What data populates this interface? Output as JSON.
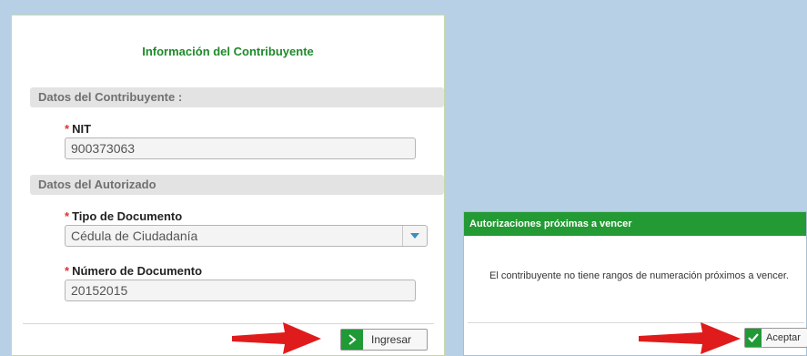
{
  "form": {
    "title": "Información del Contribuyente",
    "section_contribuyente": "Datos del Contribuyente :",
    "nit_label": "NIT",
    "nit_value": "900373063",
    "section_autorizado": "Datos del Autorizado",
    "tipo_doc_label": "Tipo de Documento",
    "tipo_doc_value": "Cédula de Ciudadanía",
    "numero_doc_label": "Número de Documento",
    "numero_doc_value": "20152015",
    "required_mark": "*",
    "submit_label": "Ingresar"
  },
  "dialog": {
    "title": "Autorizaciones próximas a vencer",
    "message": "El contribuyente no tiene rangos de numeración próximos a vencer.",
    "accept_label": "Aceptar"
  },
  "colors": {
    "accent_green": "#1f9a35",
    "annotation_red": "#e01b1b",
    "background": "#b8d0e6"
  },
  "icons": {
    "submit_icon": "chevron-right-icon",
    "accept_icon": "checkmark-icon",
    "select_icon": "caret-down-icon",
    "annotation": "red-arrow-icon"
  }
}
